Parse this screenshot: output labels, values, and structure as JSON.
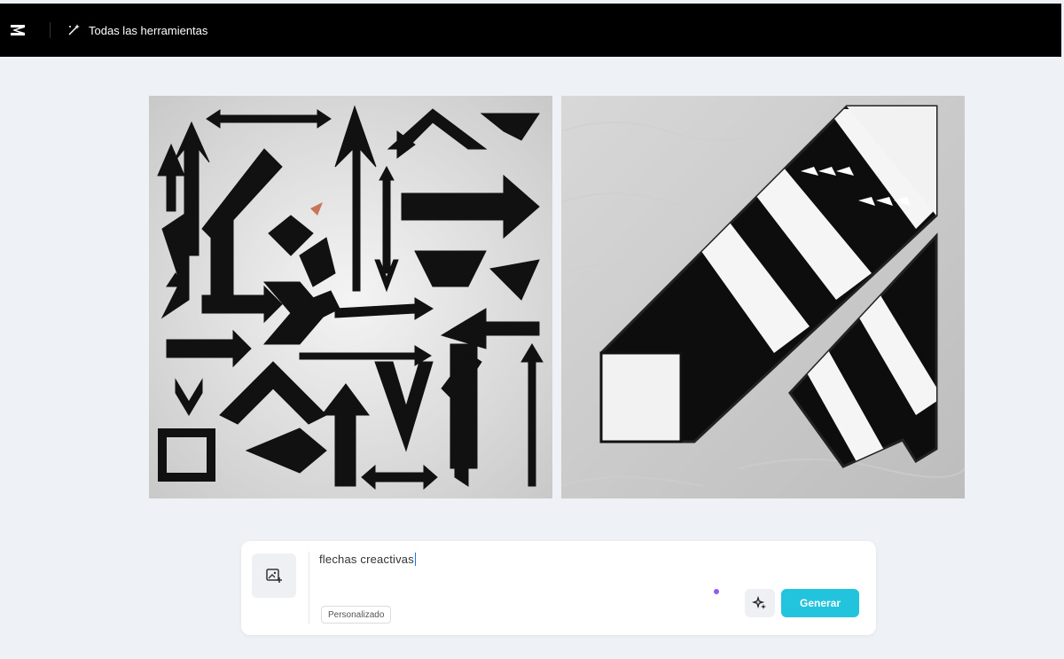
{
  "header": {
    "logo_icon": "capcut-logo-icon",
    "tools_label": "Todas las herramientas",
    "tools_icon": "magic-wand-icon"
  },
  "gallery": {
    "images": [
      {
        "name": "arrows-collection-image"
      },
      {
        "name": "striped-arrow-image"
      }
    ]
  },
  "prompt": {
    "value": "flechas creactivas",
    "tag_label": "Personalizado",
    "generate_label": "Generar",
    "upload_icon": "image-add-icon",
    "magic_icon": "sparkle-icon"
  },
  "colors": {
    "topbar": "#000000",
    "background": "#eef1f5",
    "accent": "#22c3dc",
    "dot": "#8b5cf6"
  }
}
